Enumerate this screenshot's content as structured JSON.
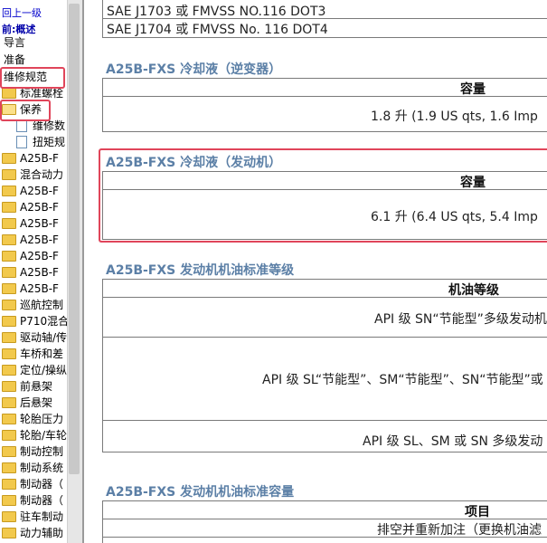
{
  "sidebar": {
    "back_link": "回上一级",
    "overview": "前:概述",
    "items": [
      {
        "label": "导言"
      },
      {
        "label": "准备"
      },
      {
        "label": "维修规范"
      },
      {
        "label": "标准螺栓"
      },
      {
        "label": "保养"
      },
      {
        "label": "维修数"
      },
      {
        "label": "扭矩规"
      },
      {
        "label": "A25B-F"
      },
      {
        "label": "混合动力"
      },
      {
        "label": "A25B-F"
      },
      {
        "label": "A25B-F"
      },
      {
        "label": "A25B-F"
      },
      {
        "label": "A25B-F"
      },
      {
        "label": "A25B-F"
      },
      {
        "label": "A25B-F"
      },
      {
        "label": "A25B-F"
      },
      {
        "label": "巡航控制"
      },
      {
        "label": "P710混合"
      },
      {
        "label": "驱动轴/传"
      },
      {
        "label": "车桥和差"
      },
      {
        "label": "定位/操纵"
      },
      {
        "label": "前悬架"
      },
      {
        "label": "后悬架"
      },
      {
        "label": "轮胎压力"
      },
      {
        "label": "轮胎/车轮"
      },
      {
        "label": "制动控制"
      },
      {
        "label": "制动系统"
      },
      {
        "label": "制动器（"
      },
      {
        "label": "制动器（"
      },
      {
        "label": "驻车制动"
      },
      {
        "label": "动力辅助"
      }
    ]
  },
  "main": {
    "top_rows": [
      "SAE J1703 或 FMVSS NO.116 DOT3",
      "SAE J1704 或 FMVSS No. 116 DOT4"
    ],
    "inverter": {
      "title": "A25B-FXS 冷却液（逆变器）",
      "header": "容量",
      "value": "1.8 升 (1.9 US qts, 1.6 Imp"
    },
    "engine": {
      "title": "A25B-FXS 冷却液（发动机）",
      "header": "容量",
      "value": "6.1 升 (6.4 US qts, 5.4 Imp"
    },
    "oil_grade": {
      "title": "A25B-FXS 发动机机油标准等级",
      "header": "机油等级",
      "rows": [
        "API 级 SN“节能型”多级发动机",
        "API 级 SL“节能型”、SM“节能型”、SN“节能型”或",
        "API 级 SL、SM 或 SN 多级发动"
      ]
    },
    "oil_capacity": {
      "title": "A25B-FXS 发动机机油标准容量",
      "header": "项目",
      "row1": "排空并重新加注（更换机油滤"
    }
  }
}
